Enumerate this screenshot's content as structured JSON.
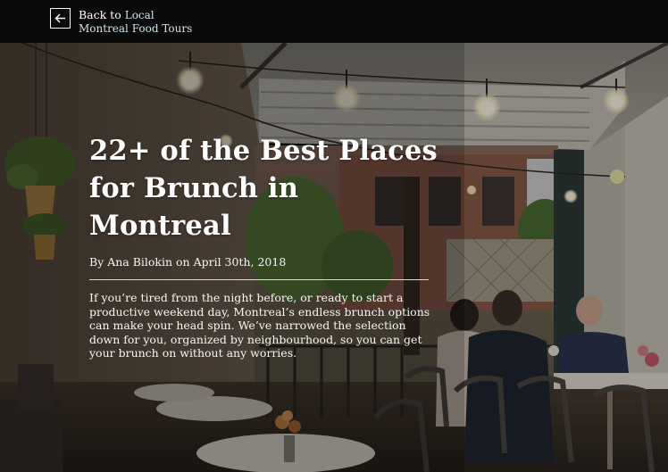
{
  "nav": {
    "back_prefix": "Back to",
    "back_site_line1": "Local",
    "back_site_line2": "Montreal Food Tours",
    "back_icon": "arrow-left-icon"
  },
  "article": {
    "title": "22+ of the Best Places for Brunch in Montreal",
    "byline": "By Ana Bilokin on April 30th, 2018",
    "intro": "If you’re tired from the night before, or ready to start a productive weekend day, Montreal’s endless brunch options can make your head spin. We’ve narrowed the selection down for you, organized by neighbourhood, so you can get your brunch on without any worries."
  },
  "colors": {
    "topbar": "#0b0b0b",
    "link_accent": "#c9e6ee"
  }
}
